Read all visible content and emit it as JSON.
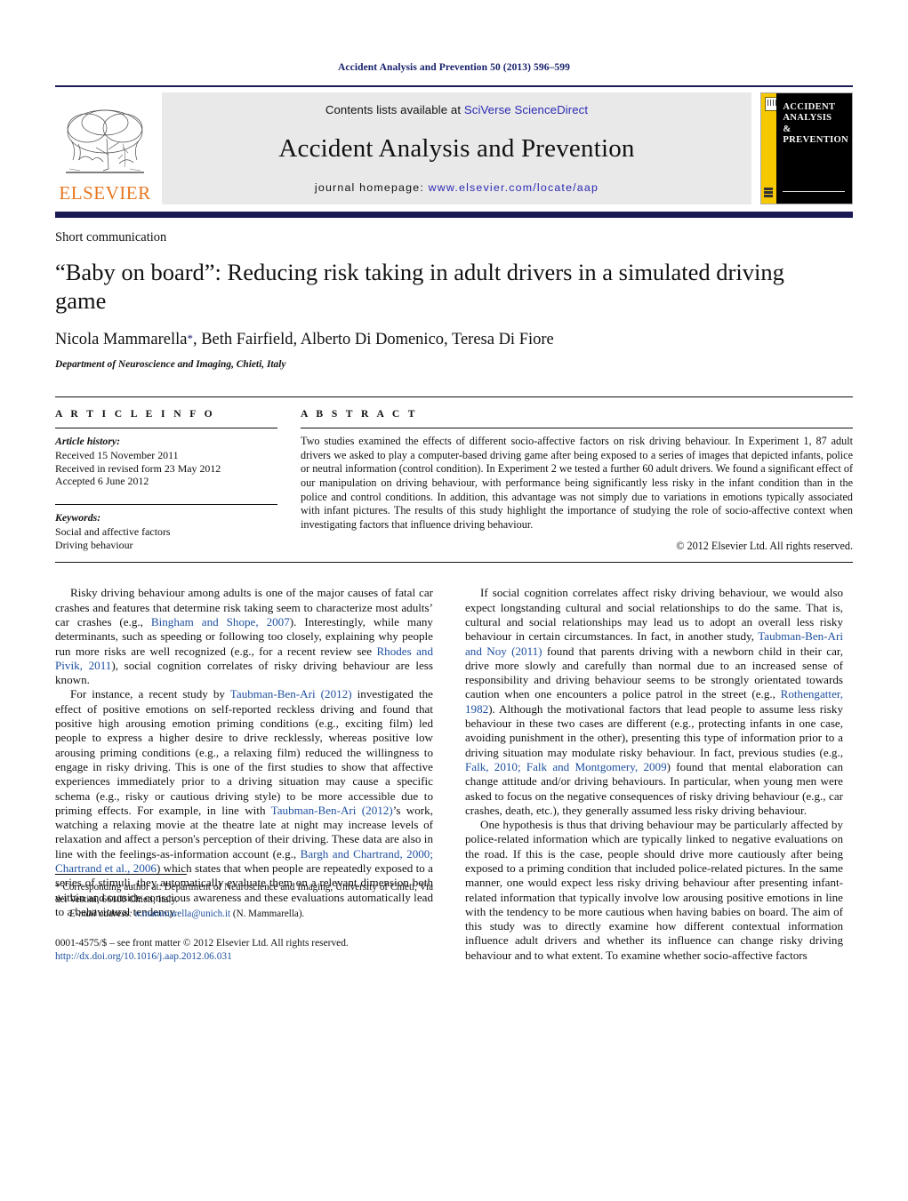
{
  "running_head": "Accident Analysis and Prevention 50 (2013) 596–599",
  "masthead": {
    "publisher_name": "ELSEVIER",
    "publisher_logo_alt": "tree-logo",
    "contents_prefix": "Contents lists available at ",
    "contents_link": "SciVerse ScienceDirect",
    "journal_title": "Accident Analysis and Prevention",
    "homepage_prefix": "journal homepage: ",
    "homepage_url": "www.elsevier.com/locate/aap",
    "cover_title": "ACCIDENT ANALYSIS & PREVENTION",
    "cover_lines": [
      "ACCIDENT",
      "ANALYSIS",
      "&",
      "PREVENTION"
    ]
  },
  "article": {
    "kicker": "Short communication",
    "title": "“Baby on board”: Reducing risk taking in adult drivers in a simulated driving game",
    "authors": "Nicola Mammarella",
    "authors_rest": ", Beth Fairfield, Alberto Di Domenico, Teresa Di Fiore",
    "corresponding_marker": "*",
    "affiliation": "Department of Neuroscience and Imaging, Chieti, Italy"
  },
  "article_info": {
    "heading": "A R T I C L E     I N F O",
    "history_label": "Article history:",
    "history": [
      "Received 15 November 2011",
      "Received in revised form 23 May 2012",
      "Accepted 6 June 2012"
    ],
    "keywords_label": "Keywords:",
    "keywords": [
      "Social and affective factors",
      "Driving behaviour"
    ]
  },
  "abstract": {
    "heading": "A B S T R A C T",
    "text": "Two studies examined the effects of different socio-affective factors on risk driving behaviour. In Experiment 1, 87 adult drivers we asked to play a computer-based driving game after being exposed to a series of images that depicted infants, police or neutral information (control condition). In Experiment 2 we tested a further 60 adult drivers. We found a significant effect of our manipulation on driving behaviour, with performance being significantly less risky in the infant condition than in the police and control conditions. In addition, this advantage was not simply due to variations in emotions typically associated with infant pictures. The results of this study highlight the importance of studying the role of socio-affective context when investigating factors that influence driving behaviour.",
    "copyright": "© 2012 Elsevier Ltd. All rights reserved."
  },
  "body": {
    "left_column": [
      {
        "segments": [
          {
            "t": "Risky driving behaviour among adults is one of the major causes of fatal car crashes and features that determine risk taking seem to characterize most adults’ car crashes (e.g., ",
            "ref": false
          },
          {
            "t": "Bingham and Shope, 2007",
            "ref": true
          },
          {
            "t": "). Interestingly, while many determinants, such as speeding or following too closely, explaining why people run more risks are well recognized (e.g., for a recent review see ",
            "ref": false
          },
          {
            "t": "Rhodes and Pivik, 2011",
            "ref": true
          },
          {
            "t": "), social cognition correlates of risky driving behaviour are less known.",
            "ref": false
          }
        ]
      },
      {
        "segments": [
          {
            "t": "For instance, a recent study by ",
            "ref": false
          },
          {
            "t": "Taubman-Ben-Ari (2012)",
            "ref": true
          },
          {
            "t": " investigated the effect of positive emotions on self-reported reckless driving and found that positive high arousing emotion priming conditions (e.g., exciting film) led people to express a higher desire to drive recklessly, whereas positive low arousing priming conditions (e.g., a relaxing film) reduced the willingness to engage in risky driving. This is one of the first studies to show that affective experiences immediately prior to a driving situation may cause a specific schema (e.g., risky or cautious driving style) to be more accessible due to priming effects. For example, in line with ",
            "ref": false
          },
          {
            "t": "Taubman-Ben-Ari (2012)",
            "ref": true
          },
          {
            "t": "’s work, watching a relaxing movie at the theatre late at night may increase levels of relaxation and affect a person's perception of their driving. These data are also in line with the feelings-as-information account (e.g., ",
            "ref": false
          },
          {
            "t": "Bargh and Chartrand, 2000; Chartrand et al., 2006",
            "ref": true
          },
          {
            "t": ") which states that when people are repeatedly exposed to a series of stimuli, they automatically evaluate them on a relevant dimension both within and outside conscious awareness and these evaluations automatically lead to a behavioural tendency.",
            "ref": false
          }
        ]
      }
    ],
    "right_column": [
      {
        "segments": [
          {
            "t": "If social cognition correlates affect risky driving behaviour, we would also expect longstanding cultural and social relationships to do the same. That is, cultural and social relationships may lead us to adopt an overall less risky behaviour in certain circumstances. In fact, in another study, ",
            "ref": false
          },
          {
            "t": "Taubman-Ben-Ari and Noy (2011)",
            "ref": true
          },
          {
            "t": " found that parents driving with a newborn child in their car, drive more slowly and carefully than normal due to an increased sense of responsibility and driving behaviour seems to be strongly orientated towards caution when one encounters a police patrol in the street (e.g., ",
            "ref": false
          },
          {
            "t": "Rothengatter, 1982",
            "ref": true
          },
          {
            "t": "). Although the motivational factors that lead people to assume less risky behaviour in these two cases are different (e.g., protecting infants in one case, avoiding punishment in the other), presenting this type of information prior to a driving situation may modulate risky behaviour. In fact, previous studies (e.g., ",
            "ref": false
          },
          {
            "t": "Falk, 2010; Falk and Montgomery, 2009",
            "ref": true
          },
          {
            "t": ") found that mental elaboration can change attitude and/or driving behaviours. In particular, when young men were asked to focus on the negative consequences of risky driving behaviour (e.g., car crashes, death, etc.), they generally assumed less risky driving behaviour.",
            "ref": false
          }
        ]
      },
      {
        "segments": [
          {
            "t": "One hypothesis is thus that driving behaviour may be particularly affected by police-related information which are typically linked to negative evaluations on the road. If this is the case, people should drive more cautiously after being exposed to a priming condition that included police-related pictures. In the same manner, one would expect less risky driving behaviour after presenting infant-related information that typically involve low arousing positive emotions in line with the tendency to be more cautious when having babies on board. The aim of this study was to directly examine how different contextual information influence adult drivers and whether its influence can change risky driving behaviour and to what extent. To examine whether socio-affective factors",
            "ref": false
          }
        ]
      }
    ]
  },
  "footnotes": {
    "corresponding_star": "*",
    "corresponding_text": " Corresponding author at: Department of Neuroscience and Imaging, University of Chieti, Via dei Vestini, 66100 Chieti, Italy.",
    "email_label": "E-mail address:",
    "email": "n.mammarella@unich.it",
    "email_suffix": " (N. Mammarella).",
    "issn_line": "0001-4575/$ – see front matter © 2012 Elsevier Ltd. All rights reserved.",
    "doi": "http://dx.doi.org/10.1016/j.aap.2012.06.031"
  },
  "colors": {
    "link_blue": "#1d4f9e",
    "head_navy": "#16206b",
    "elsevier_orange": "#e87722",
    "cover_yellow": "#f5c800"
  }
}
